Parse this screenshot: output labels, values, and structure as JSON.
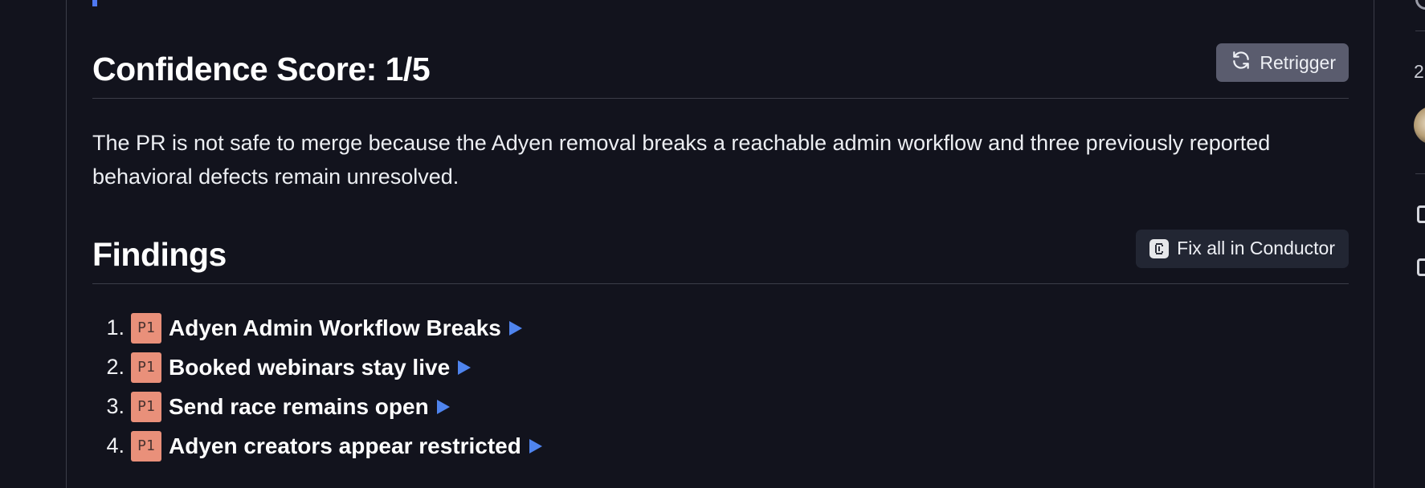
{
  "confidence": {
    "title": "Confidence Score: 1/5",
    "retrigger_label": "Retrigger"
  },
  "summary": "The PR is not safe to merge because the Adyen removal breaks a reachable admin workflow and three previously reported behavioral defects remain unresolved.",
  "findings": {
    "title": "Findings",
    "fix_all_label": "Fix all in Conductor",
    "items": [
      {
        "number": "1.",
        "priority": "P1",
        "title": "Adyen Admin Workflow Breaks"
      },
      {
        "number": "2.",
        "priority": "P1",
        "title": "Booked webinars stay live"
      },
      {
        "number": "3.",
        "priority": "P1",
        "title": "Send race remains open"
      },
      {
        "number": "4.",
        "priority": "P1",
        "title": "Adyen creators appear restricted"
      }
    ]
  },
  "sidebar": {
    "count": "2"
  },
  "colors": {
    "background": "#12131d",
    "accent": "#4f79f2",
    "badge": "#e9907a",
    "retrigger_button": "#5a5c6e",
    "conductor_button": "#222633",
    "expand_arrow": "#4f84ee"
  },
  "icons": {
    "retrigger": "refresh-icon",
    "conductor": "conductor-logo-icon",
    "expand": "play-triangle-icon"
  }
}
